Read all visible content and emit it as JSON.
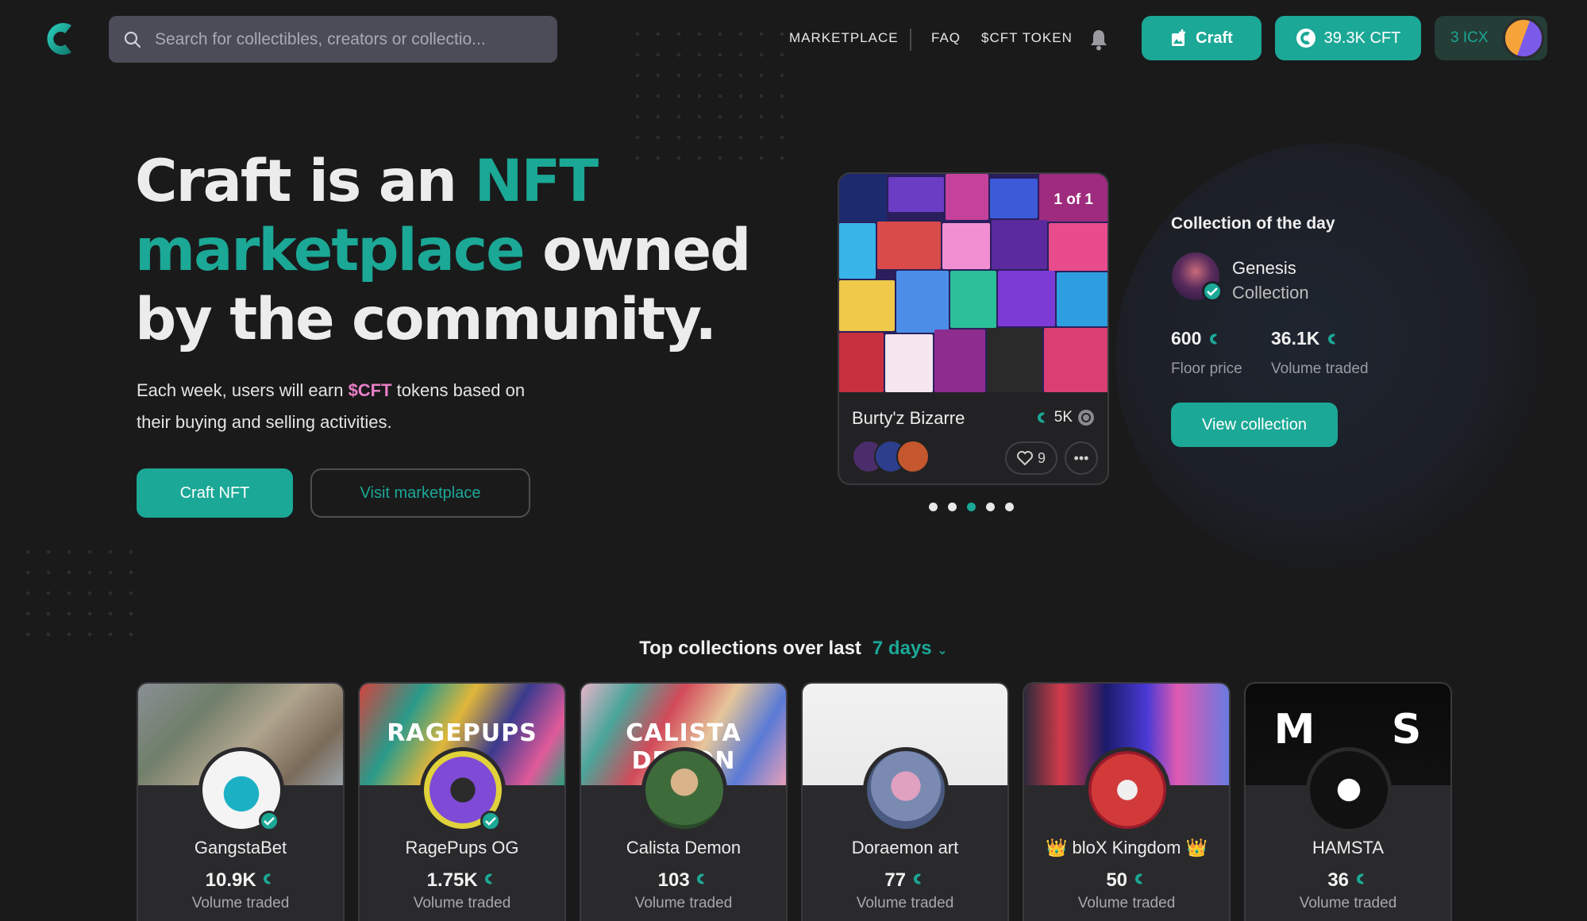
{
  "header": {
    "search_placeholder": "Search for collectibles, creators or collectio...",
    "nav": [
      "MARKETPLACE",
      "FAQ",
      "$CFT TOKEN"
    ],
    "craft_button": "Craft",
    "token_balance": "39.3K CFT",
    "wallet_balance": "3 ICX"
  },
  "hero": {
    "title_part1": "Craft is an ",
    "title_accent": "NFT marketplace",
    "title_part2": " owned by the community.",
    "subtitle_part1": "Each week, users will earn ",
    "subtitle_token": "$CFT",
    "subtitle_part2": " tokens based on their buying and selling activities.",
    "primary_button": "Craft NFT",
    "secondary_button": "Visit marketplace"
  },
  "featured": {
    "badge": "1 of 1",
    "name": "Burty'z Bizarre",
    "price": "5K",
    "likes": "9",
    "carousel_count": 5,
    "carousel_active": 2
  },
  "collection_of_day": {
    "title": "Collection of the day",
    "name": "Genesis",
    "subtitle": "Collection",
    "floor_value": "600",
    "floor_label": "Floor price",
    "volume_value": "36.1K",
    "volume_label": "Volume traded",
    "button": "View collection"
  },
  "top_collections": {
    "title": "Top collections over last",
    "period": "7 days",
    "items": [
      {
        "name": "GangstaBet",
        "volume": "10.9K",
        "label": "Volume traded",
        "verified": true
      },
      {
        "name": "RagePups OG",
        "volume": "1.75K",
        "label": "Volume traded",
        "verified": true,
        "banner_text": "RAGEPUPS"
      },
      {
        "name": "Calista Demon",
        "volume": "103",
        "label": "Volume traded",
        "verified": false,
        "banner_text": "CALISTA DEMON"
      },
      {
        "name": "Doraemon art",
        "volume": "77",
        "label": "Volume traded",
        "verified": false
      },
      {
        "name": "👑 bloX Kingdom 👑",
        "volume": "50",
        "label": "Volume traded",
        "verified": false
      },
      {
        "name": "HAMSTA",
        "volume": "36",
        "label": "Volume traded",
        "verified": false,
        "banner_text": "M     S"
      }
    ]
  },
  "colors": {
    "accent": "#1ba896",
    "background": "#1a1a1b",
    "token_pink": "#e87fc6"
  }
}
